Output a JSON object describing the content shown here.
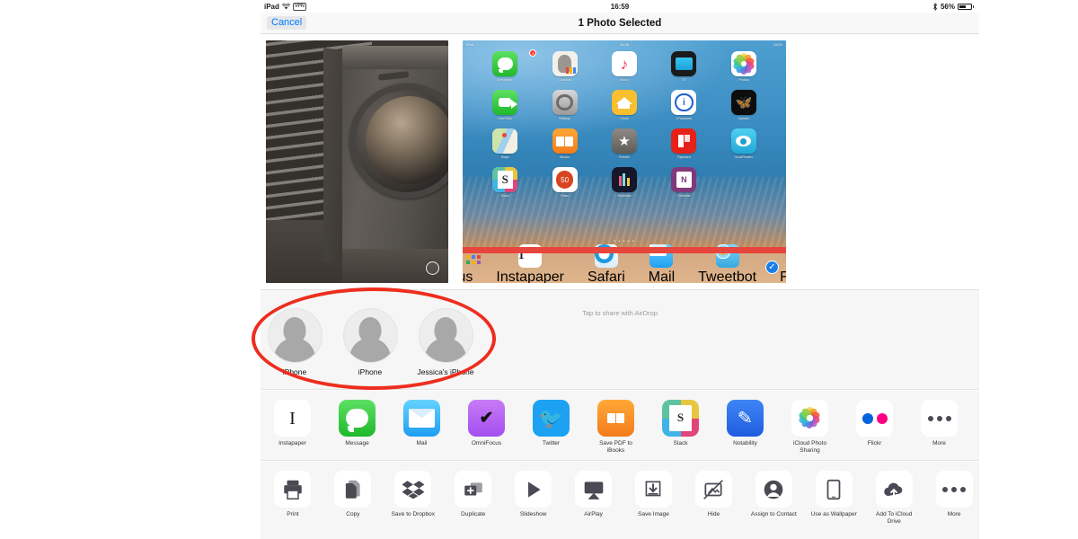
{
  "status_bar": {
    "device": "iPad",
    "wifi_icon": "wifi-icon",
    "vpn": "VPN",
    "time": "16:59",
    "bluetooth_icon": "bluetooth-icon",
    "battery_percent": "56%",
    "battery_level": 56
  },
  "nav": {
    "cancel_label": "Cancel",
    "title": "1 Photo Selected"
  },
  "photos": [
    {
      "name": "laundry-machine-photo",
      "selected": false,
      "alt": "Washing machine in corrugated metal garage"
    },
    {
      "name": "ipad-home-screen-photo",
      "selected": true,
      "alt": "iPad home screen screenshot"
    }
  ],
  "ipad_screenshot": {
    "status": {
      "left": "iPad",
      "time": "16:58",
      "right": "100%"
    },
    "page_dots": "• • • • •",
    "apps": [
      {
        "label": "Messages",
        "icon": "messages-icon",
        "badge": "4"
      },
      {
        "label": "Contacts",
        "icon": "contacts-icon"
      },
      {
        "label": "Music",
        "icon": "music-icon"
      },
      {
        "label": "TV",
        "icon": "tv-icon"
      },
      {
        "label": "Photos",
        "icon": "photos-icon"
      },
      {
        "label": "FaceTime",
        "icon": "facetime-icon"
      },
      {
        "label": "Settings",
        "icon": "settings-icon"
      },
      {
        "label": "Home",
        "icon": "home-icon"
      },
      {
        "label": "1Password",
        "icon": "onepassword-icon"
      },
      {
        "label": "Ulysses",
        "icon": "ulysses-icon"
      },
      {
        "label": "Maps",
        "icon": "maps-icon"
      },
      {
        "label": "iBooks",
        "icon": "ibooks-icon"
      },
      {
        "label": "Reeder",
        "icon": "reeder-icon"
      },
      {
        "label": "Flipboard",
        "icon": "flipboard-icon"
      },
      {
        "label": "GoodReader",
        "icon": "goodreader-icon"
      },
      {
        "label": "Slack",
        "icon": "slack-icon"
      },
      {
        "label": "Pcalc",
        "icon": "pcalc-icon"
      },
      {
        "label": "Workflow",
        "icon": "workflow-icon"
      },
      {
        "label": "OneNote",
        "icon": "onenote-icon"
      }
    ],
    "dock": [
      {
        "label": "OmniFocus",
        "icon": "omnifocus-icon"
      },
      {
        "label": "Instapaper",
        "icon": "instapaper-icon"
      },
      {
        "label": "Safari",
        "icon": "safari-icon"
      },
      {
        "label": "Mail",
        "icon": "mail-icon"
      },
      {
        "label": "Tweetbot",
        "icon": "tweetbot-icon"
      },
      {
        "label": "Fantastical",
        "icon": "fantastical-icon"
      }
    ]
  },
  "airdrop": {
    "hint": "Tap to share with AirDrop",
    "devices": [
      {
        "name": "iPhone",
        "avatar": "person-silhouette-avatar"
      },
      {
        "name": "iPhone",
        "avatar": "person-silhouette-avatar"
      },
      {
        "name": "Jessica's iPhone",
        "avatar": "person-silhouette-avatar"
      }
    ]
  },
  "share_apps": [
    {
      "label": "Instapaper",
      "icon": "instapaper-icon"
    },
    {
      "label": "Message",
      "icon": "messages-icon"
    },
    {
      "label": "Mail",
      "icon": "mail-icon"
    },
    {
      "label": "OmniFocus",
      "icon": "omnifocus-icon"
    },
    {
      "label": "Twitter",
      "icon": "twitter-icon"
    },
    {
      "label": "Save PDF to iBooks",
      "icon": "ibooks-icon"
    },
    {
      "label": "Slack",
      "icon": "slack-icon"
    },
    {
      "label": "Notability",
      "icon": "notability-icon"
    },
    {
      "label": "iCloud Photo Sharing",
      "icon": "photos-icon"
    },
    {
      "label": "Flickr",
      "icon": "flickr-icon"
    },
    {
      "label": "More",
      "icon": "more-dots-icon"
    }
  ],
  "actions": [
    {
      "label": "Print",
      "icon": "printer-icon"
    },
    {
      "label": "Copy",
      "icon": "copy-pages-icon"
    },
    {
      "label": "Save to Dropbox",
      "icon": "dropbox-icon"
    },
    {
      "label": "Duplicate",
      "icon": "duplicate-plus-icon"
    },
    {
      "label": "Slideshow",
      "icon": "play-triangle-icon"
    },
    {
      "label": "AirPlay",
      "icon": "airplay-icon"
    },
    {
      "label": "Save Image",
      "icon": "download-arrow-icon"
    },
    {
      "label": "Hide",
      "icon": "hide-slash-icon"
    },
    {
      "label": "Assign to Contact",
      "icon": "person-circle-icon"
    },
    {
      "label": "Use as Wallpaper",
      "icon": "tablet-icon"
    },
    {
      "label": "Add To iCloud Drive",
      "icon": "icloud-upload-icon"
    },
    {
      "label": "More",
      "icon": "more-dots-icon"
    }
  ],
  "annotation": {
    "name": "red-ellipse-highlight",
    "color": "#ee2d1e",
    "targets": "airdrop-device-list"
  },
  "colors": {
    "accent_blue": "#007aff",
    "annotation_red": "#ee2d1e",
    "sheet_background": "#f6f6f6"
  }
}
